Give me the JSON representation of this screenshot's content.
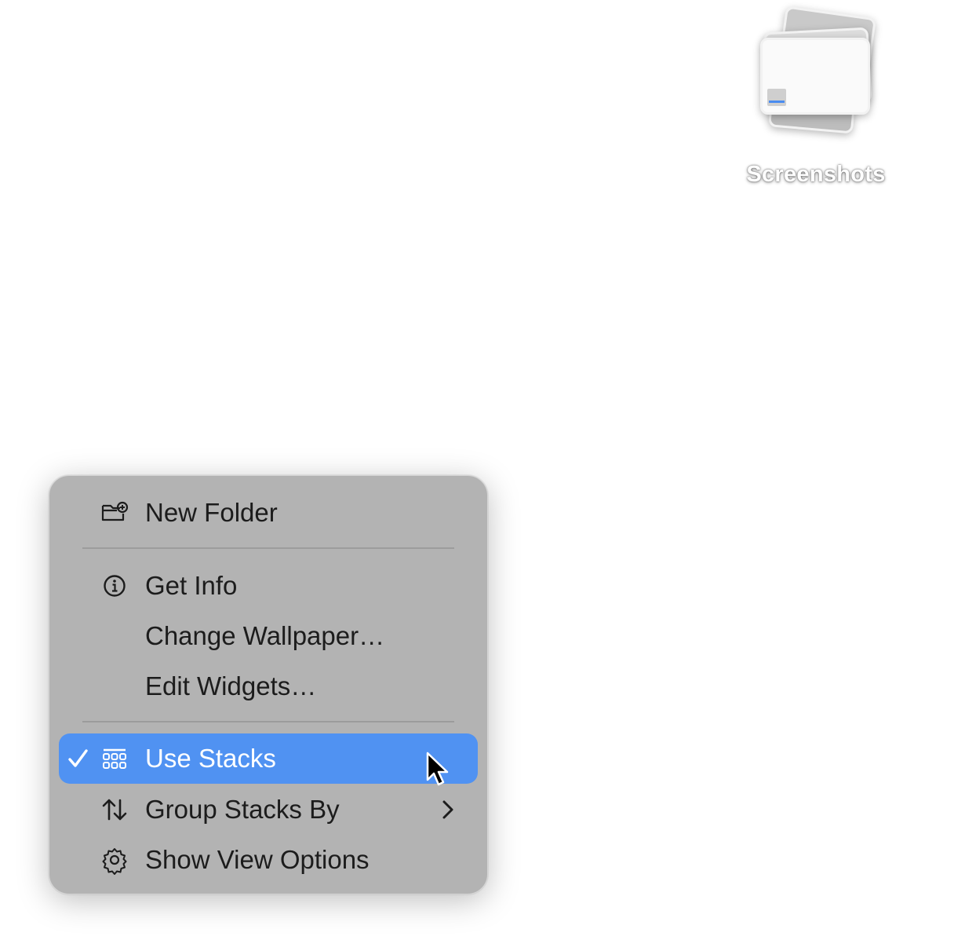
{
  "desktop": {
    "stack": {
      "label": "Screenshots",
      "icon": "stack-icon"
    }
  },
  "context_menu": {
    "items": [
      {
        "label": "New Folder",
        "icon": "new-folder-icon"
      },
      {
        "label": "Get Info",
        "icon": "info-icon"
      },
      {
        "label": "Change Wallpaper…",
        "icon": ""
      },
      {
        "label": "Edit Widgets…",
        "icon": ""
      },
      {
        "label": "Use Stacks",
        "icon": "stacks-icon",
        "checked": true,
        "highlighted": true
      },
      {
        "label": "Group Stacks By",
        "icon": "sort-arrows-icon",
        "submenu": true
      },
      {
        "label": "Show View Options",
        "icon": "gear-icon"
      }
    ],
    "colors": {
      "background": "#b3b3b3",
      "highlight": "#5092f2",
      "text": "#1c1c1c"
    }
  },
  "cursor": "arrow-pointer-icon"
}
